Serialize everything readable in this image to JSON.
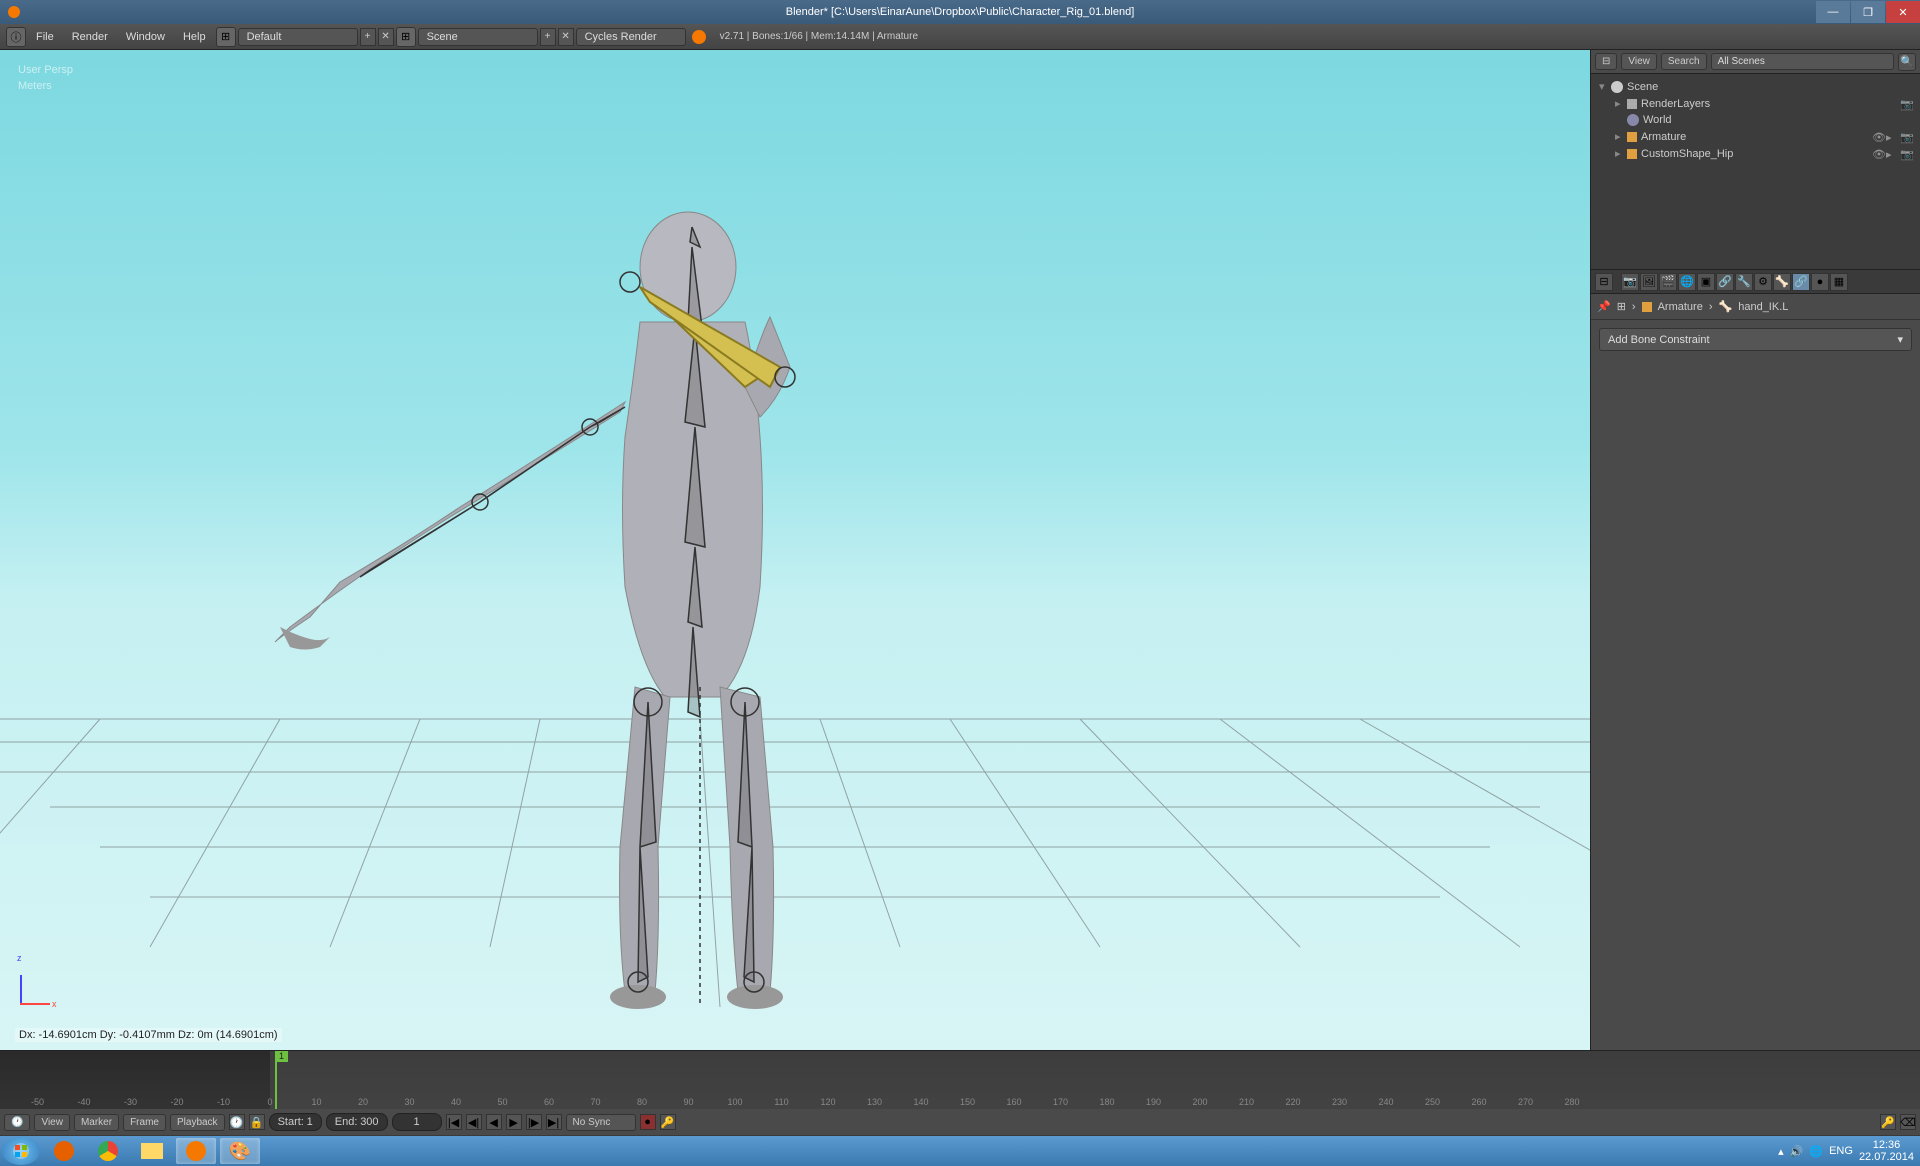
{
  "title": "Blender* [C:\\Users\\EinarAune\\Dropbox\\Public\\Character_Rig_01.blend]",
  "menus": {
    "file": "File",
    "render": "Render",
    "window": "Window",
    "help": "Help"
  },
  "layout_dropdown": "Default",
  "scene_dropdown": "Scene",
  "render_engine": "Cycles Render",
  "status_text": "v2.71 | Bones:1/66 | Mem:14.14M | Armature",
  "viewport": {
    "persp": "User Persp",
    "units": "Meters",
    "transform_readout": "Dx: -14.6901cm  Dy: -0.4107mm  Dz: 0m (14.6901cm)"
  },
  "outliner": {
    "view_btn": "View",
    "search_btn": "Search",
    "filter_dropdown": "All Scenes",
    "tree": [
      {
        "level": 0,
        "label": "Scene",
        "icon_color": "#ccc"
      },
      {
        "level": 1,
        "label": "RenderLayers",
        "icon_color": "#ccc"
      },
      {
        "level": 1,
        "label": "World",
        "icon_color": "#ccc"
      },
      {
        "level": 1,
        "label": "Armature",
        "icon_color": "#e0a040"
      },
      {
        "level": 1,
        "label": "CustomShape_Hip",
        "icon_color": "#e0a040"
      }
    ]
  },
  "properties": {
    "breadcrumb_object": "Armature",
    "breadcrumb_bone": "hand_IK.L",
    "add_constraint": "Add Bone Constraint"
  },
  "timeline": {
    "view": "View",
    "marker": "Marker",
    "frame": "Frame",
    "playback": "Playback",
    "start_label": "Start:",
    "start_val": "1",
    "end_label": "End:",
    "end_val": "300",
    "current_val": "1",
    "sync": "No Sync",
    "playhead_frame": "1",
    "ticks": [
      -50,
      -40,
      -30,
      -20,
      -10,
      0,
      10,
      20,
      30,
      40,
      50,
      60,
      70,
      80,
      90,
      100,
      110,
      120,
      130,
      140,
      150,
      160,
      170,
      180,
      190,
      200,
      210,
      220,
      230,
      240,
      250,
      260,
      270,
      280
    ]
  },
  "systray": {
    "lang": "ENG",
    "time": "12:36",
    "date": "22.07.2014"
  }
}
